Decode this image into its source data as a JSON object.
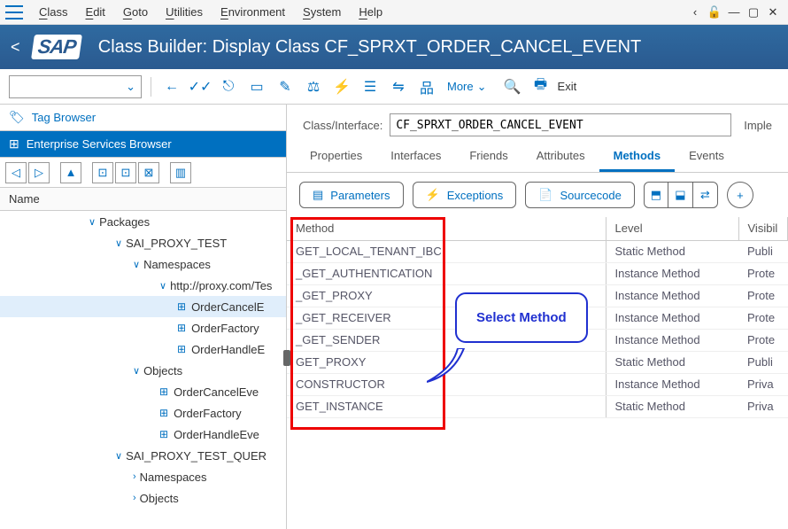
{
  "menu": {
    "items": [
      "Class",
      "Edit",
      "Goto",
      "Utilities",
      "Environment",
      "System",
      "Help"
    ]
  },
  "title": "Class Builder: Display Class CF_SPRXT_ORDER_CANCEL_EVENT",
  "logo": "SAP",
  "toolbar": {
    "more": "More",
    "exit": "Exit"
  },
  "left": {
    "tag": "Tag Browser",
    "esb": "Enterprise Services Browser",
    "name_hdr": "Name",
    "nodes": [
      {
        "indent": 100,
        "tw": "∨",
        "label": "Packages"
      },
      {
        "indent": 130,
        "tw": "∨",
        "label": "SAI_PROXY_TEST"
      },
      {
        "indent": 150,
        "tw": "∨",
        "label": "Namespaces"
      },
      {
        "indent": 180,
        "tw": "∨",
        "label": "http://proxy.com/Tes"
      },
      {
        "indent": 200,
        "ico": "⊞",
        "label": "OrderCancelE",
        "sel": true
      },
      {
        "indent": 200,
        "ico": "⊞",
        "label": "OrderFactory"
      },
      {
        "indent": 200,
        "ico": "⊞",
        "label": "OrderHandleE"
      },
      {
        "indent": 150,
        "tw": "∨",
        "label": "Objects"
      },
      {
        "indent": 180,
        "ico": "⊞",
        "label": "OrderCancelEve"
      },
      {
        "indent": 180,
        "ico": "⊞",
        "label": "OrderFactory"
      },
      {
        "indent": 180,
        "ico": "⊞",
        "label": "OrderHandleEve"
      },
      {
        "indent": 130,
        "tw": "∨",
        "label": "SAI_PROXY_TEST_QUER"
      },
      {
        "indent": 150,
        "tw": "›",
        "label": "Namespaces"
      },
      {
        "indent": 150,
        "tw": "›",
        "label": "Objects"
      }
    ]
  },
  "right": {
    "class_label": "Class/Interface:",
    "class_value": "CF_SPRXT_ORDER_CANCEL_EVENT",
    "impl": "Imple",
    "tabs": [
      "Properties",
      "Interfaces",
      "Friends",
      "Attributes",
      "Methods",
      "Events"
    ],
    "active_tab": 4,
    "buttons": {
      "params": "Parameters",
      "exc": "Exceptions",
      "src": "Sourcecode"
    },
    "grid_hdr": {
      "method": "Method",
      "level": "Level",
      "vis": "Visibil"
    },
    "rows": [
      {
        "m": "GET_LOCAL_TENANT_IBC",
        "l": "Static Method",
        "v": "Publi"
      },
      {
        "m": "_GET_AUTHENTICATION",
        "l": "Instance Method",
        "v": "Prote"
      },
      {
        "m": "_GET_PROXY",
        "l": "Instance Method",
        "v": "Prote"
      },
      {
        "m": "_GET_RECEIVER",
        "l": "Instance Method",
        "v": "Prote"
      },
      {
        "m": "_GET_SENDER",
        "l": "Instance Method",
        "v": "Prote"
      },
      {
        "m": "GET_PROXY",
        "l": "Static Method",
        "v": "Publi"
      },
      {
        "m": "CONSTRUCTOR",
        "l": "Instance Method",
        "v": "Priva"
      },
      {
        "m": "GET_INSTANCE",
        "l": "Static Method",
        "v": "Priva"
      }
    ]
  },
  "callout": "Select Method"
}
